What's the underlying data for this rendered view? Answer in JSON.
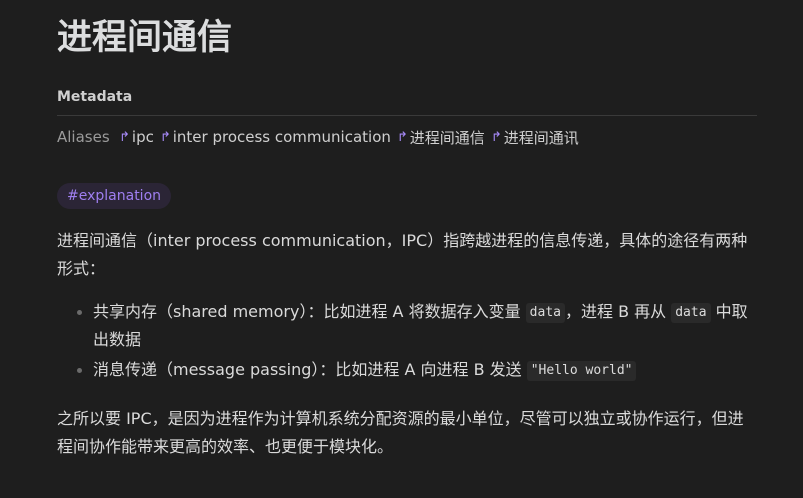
{
  "page": {
    "title": "进程间通信"
  },
  "metadata": {
    "heading": "Metadata",
    "aliases_label": "Aliases",
    "aliases": [
      {
        "icon": "alias-link-arrow-icon",
        "label": "ipc"
      },
      {
        "icon": "alias-link-arrow-icon",
        "label": "inter process communication"
      },
      {
        "icon": "alias-link-arrow-icon",
        "label": "进程间通信"
      },
      {
        "icon": "alias-link-arrow-icon",
        "label": "进程间通讯"
      }
    ]
  },
  "tag": {
    "label": "#explanation"
  },
  "content": {
    "paragraph_1": "进程间通信（inter process communication，IPC）指跨越进程的信息传递，具体的途径有两种形式：",
    "bullets": [
      {
        "before": "共享内存（shared memory）：比如进程 A 将数据存入变量",
        "code_1": "data",
        "middle": "，进程 B 再从",
        "code_2": "data",
        "after": "中取出数据"
      },
      {
        "before": "消息传递（message passing）：比如进程 A 向进程 B 发送",
        "code_1": "\"Hello world\""
      }
    ],
    "paragraph_2": "之所以要 IPC，是因为进程作为计算机系统分配资源的最小单位，尽管可以独立或协作运行，但进程间协作能带来更高的效率、也更便于模块化。"
  },
  "colors": {
    "background": "#1e1e1e",
    "accent": "#a88bfa",
    "tag_background": "#2b2536",
    "text": "#dadada"
  }
}
